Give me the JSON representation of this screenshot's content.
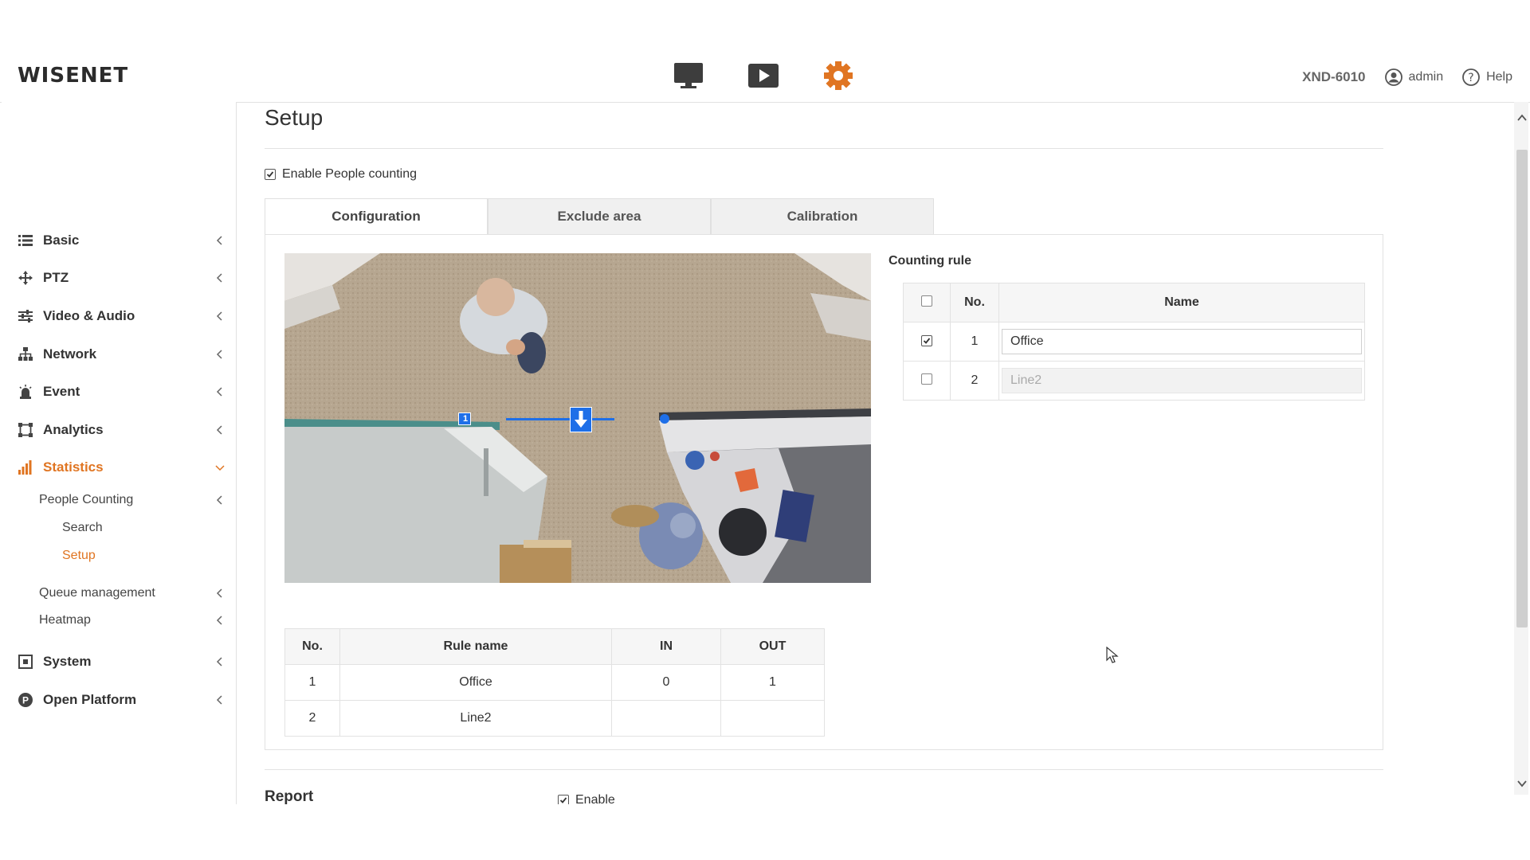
{
  "header": {
    "logo": "WISENET",
    "model": "XND-6010",
    "user": "admin",
    "help": "Help",
    "icons": [
      "monitor-icon",
      "playback-icon",
      "settings-icon"
    ],
    "accent_color": "#e07522"
  },
  "sidebar": {
    "items": [
      {
        "label": "Basic",
        "icon": "list-icon"
      },
      {
        "label": "PTZ",
        "icon": "move-icon"
      },
      {
        "label": "Video & Audio",
        "icon": "sliders-icon"
      },
      {
        "label": "Network",
        "icon": "network-icon"
      },
      {
        "label": "Event",
        "icon": "alarm-icon"
      },
      {
        "label": "Analytics",
        "icon": "analytics-icon"
      },
      {
        "label": "Statistics",
        "icon": "bar-chart-icon"
      },
      {
        "label": "System",
        "icon": "system-icon"
      },
      {
        "label": "Open Platform",
        "icon": "platform-icon"
      }
    ],
    "statistics_sub": {
      "people_counting": "People Counting",
      "search": "Search",
      "setup": "Setup",
      "queue": "Queue management",
      "heatmap": "Heatmap"
    }
  },
  "main": {
    "title": "Setup",
    "enable_label": "Enable People counting",
    "tabs": [
      "Configuration",
      "Exclude area",
      "Calibration"
    ],
    "counting_rule_title": "Counting rule",
    "rule_table": {
      "headers": [
        "No.",
        "Name"
      ],
      "rows": [
        {
          "no": "1",
          "name": "Office",
          "checked": true
        },
        {
          "no": "2",
          "name": "Line2",
          "checked": false
        }
      ]
    },
    "line_marker": "1",
    "count_table": {
      "headers": [
        "No.",
        "Rule name",
        "IN",
        "OUT"
      ],
      "rows": [
        {
          "no": "1",
          "rule": "Office",
          "in": "0",
          "out": "1"
        },
        {
          "no": "2",
          "rule": "Line2",
          "in": "",
          "out": ""
        }
      ]
    },
    "report_label": "Report",
    "report_enable": "Enable"
  }
}
